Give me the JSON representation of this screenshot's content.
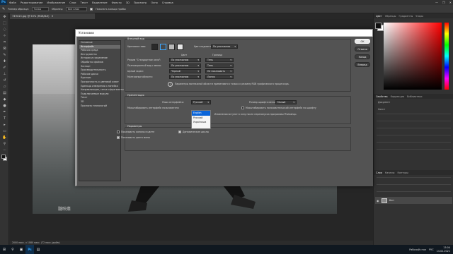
{
  "app": {
    "logo": "Ps",
    "menu": [
      "Файл",
      "Редактирование",
      "Изображение",
      "Слои",
      "Текст",
      "Выделение",
      "Фильтр",
      "3D",
      "Просмотр",
      "Окно",
      "Справка"
    ],
    "window_controls": [
      "—",
      "❐",
      "✕"
    ]
  },
  "options_bar": {
    "size_label": "Размер образца:",
    "size_value": "Точка",
    "sample_label": "Образец:",
    "sample_value": "Все слои",
    "show_ring": "Показать кольцо пробы"
  },
  "document": {
    "tab": "749413.jpg @ 50% (RGB/8#)",
    "close": "✕",
    "status": "2000 пикс. x 1080 пикс. (72 пикс./дюйм)",
    "watermark": "朧映肅"
  },
  "dialog": {
    "title": "Установки",
    "categories": [
      "Основные",
      "Интерфейс",
      "Рабочая среда",
      "Инструменты",
      "История и сохранение",
      "Обработка файлов",
      "Экспорт",
      "Производительность",
      "Рабочие диски",
      "Курсоры",
      "Прозрачность и цветовой охват",
      "Единицы измерения и линейки",
      "Направляющие, сетка и фрагменты",
      "Подключаемые модули",
      "Текст",
      "3D",
      "Просмотр технологий"
    ],
    "selected_category": 1,
    "appearance": {
      "title": "Внешний вид",
      "theme_label": "Цветовая тема:",
      "highlight_label": "Цвет подсветки:",
      "highlight_value": "По умолчанию",
      "col_color": "Цвет",
      "col_border": "Граница",
      "rows": [
        {
          "label": "Режим \"Стандартное окно\":",
          "color": "По умолчанию",
          "border": "Тень"
        },
        {
          "label": "Полноэкранный вид с меню:",
          "color": "По умолчанию",
          "border": "Тень"
        },
        {
          "label": "Целый экран:",
          "color": "Черный",
          "border": "Не показывать"
        },
        {
          "label": "Монтажные области:",
          "color": "По умолчанию",
          "border": "Линия"
        }
      ],
      "note": "Параметры монтажной области применяются только к режиму RGB графического процессора."
    },
    "presentation": {
      "title": "Презентация",
      "lang_label": "Язык интерфейса:",
      "lang_value": "Русский",
      "lang_options": [
        "English",
        "Русский",
        "Українська"
      ],
      "lang_highlight": 0,
      "font_label": "Размер шрифта меню:",
      "font_value": "Малый",
      "scale_label": "Масштабировать интерфейс пользователя",
      "scale_right": "Масштабировать пользовательский интерфейс по шрифту",
      "restart_note": "Изменения вступят в силу после перезапуска программы Photoshop."
    },
    "options": {
      "title": "Параметры",
      "items": [
        {
          "label": "Показывать каналы в цвете",
          "checked": false
        },
        {
          "label": "Динамические шкалы",
          "checked": true
        },
        {
          "label": "Показывать цвета меню",
          "checked": true
        }
      ]
    },
    "buttons": [
      "ОК",
      "Отмена",
      "Назад",
      "Вперед"
    ]
  },
  "panels": {
    "color_tabs": [
      "Цвет",
      "Образцы",
      "Градиенты",
      "Узоры"
    ],
    "props_tabs": [
      "Свойства",
      "Коррекция",
      "Библиотеки"
    ],
    "props_title": "Документ",
    "canvas_label": "Холст",
    "layers_tabs": [
      "Слои",
      "Каналы",
      "Контуры"
    ],
    "layer_name": "Фон",
    "colors": {
      "fg": "#111111",
      "bg": "#ffffff"
    }
  },
  "taskbar": {
    "time": "13:04",
    "date": "14.02.2021",
    "lang": "РУС",
    "search": "Рабочий стол"
  }
}
